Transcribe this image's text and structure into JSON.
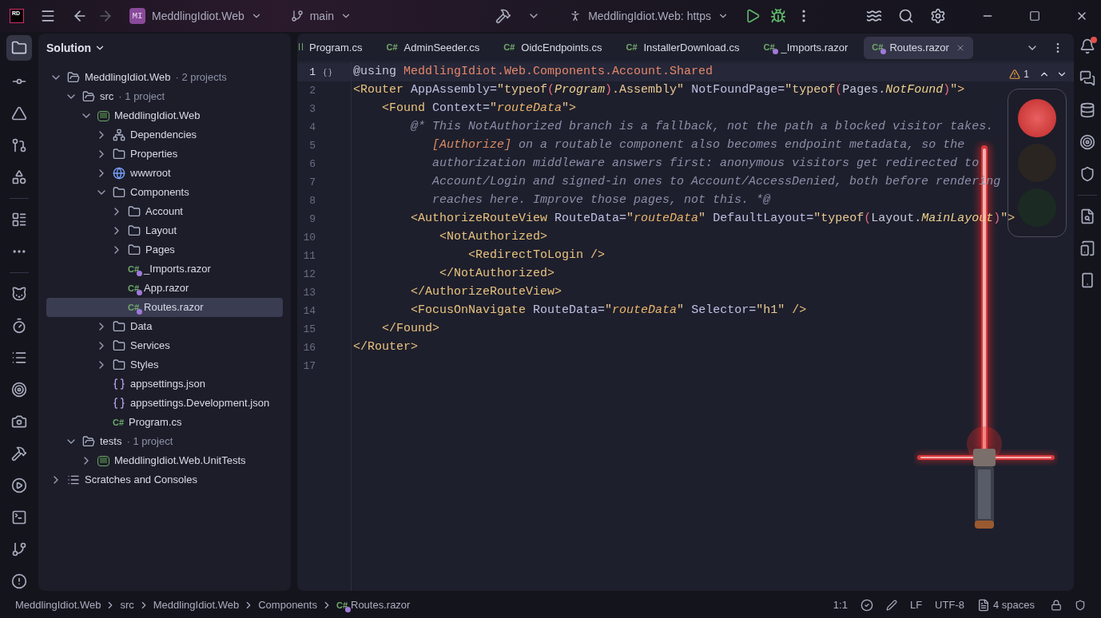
{
  "titlebar": {
    "logo": "RD",
    "project_badge": "MI",
    "project": "MeddlingIdiot.Web",
    "branch": "main",
    "run_config": "MeddlingIdiot.Web: https"
  },
  "solution": {
    "title": "Solution",
    "tree": [
      {
        "label": "MeddlingIdiot.Web",
        "meta": "· 2 projects",
        "kind": "solution",
        "expanded": true,
        "selected": false,
        "children": [
          {
            "label": "src",
            "meta": "· 1 project",
            "kind": "solution-folder",
            "expanded": true,
            "selected": false,
            "children": [
              {
                "label": "MeddlingIdiot.Web",
                "kind": "project",
                "expanded": true,
                "selected": false,
                "children": [
                  {
                    "label": "Dependencies",
                    "kind": "dependencies",
                    "expanded": false,
                    "selected": false
                  },
                  {
                    "label": "Properties",
                    "kind": "properties",
                    "expanded": false,
                    "selected": false
                  },
                  {
                    "label": "wwwroot",
                    "kind": "web-folder",
                    "expanded": false,
                    "selected": false
                  },
                  {
                    "label": "Components",
                    "kind": "folder",
                    "expanded": true,
                    "selected": false,
                    "children": [
                      {
                        "label": "Account",
                        "kind": "folder",
                        "expanded": false,
                        "selected": false
                      },
                      {
                        "label": "Layout",
                        "kind": "folder",
                        "expanded": false,
                        "selected": false
                      },
                      {
                        "label": "Pages",
                        "kind": "folder",
                        "expanded": false,
                        "selected": false
                      },
                      {
                        "label": "_Imports.razor",
                        "kind": "razor",
                        "badge": "C#",
                        "selected": false
                      },
                      {
                        "label": "App.razor",
                        "kind": "razor",
                        "badge": "C#",
                        "selected": false
                      },
                      {
                        "label": "Routes.razor",
                        "kind": "razor",
                        "badge": "C#",
                        "selected": true
                      }
                    ]
                  },
                  {
                    "label": "Data",
                    "kind": "folder",
                    "expanded": false,
                    "selected": false
                  },
                  {
                    "label": "Services",
                    "kind": "folder",
                    "expanded": false,
                    "selected": false
                  },
                  {
                    "label": "Styles",
                    "kind": "folder",
                    "expanded": false,
                    "selected": false
                  },
                  {
                    "label": "appsettings.json",
                    "kind": "json",
                    "selected": false
                  },
                  {
                    "label": "appsettings.Development.json",
                    "kind": "json",
                    "selected": false
                  },
                  {
                    "label": "Program.cs",
                    "kind": "cs",
                    "badge": "C#",
                    "selected": false
                  }
                ]
              }
            ]
          },
          {
            "label": "tests",
            "meta": "· 1 project",
            "kind": "solution-folder",
            "expanded": true,
            "selected": false,
            "children": [
              {
                "label": "MeddlingIdiot.Web.UnitTests",
                "kind": "project",
                "expanded": false,
                "selected": false
              }
            ]
          }
        ]
      },
      {
        "label": "Scratches and Consoles",
        "kind": "scratches",
        "expanded": false,
        "selected": false
      }
    ]
  },
  "tabs": [
    {
      "label": "Program.cs",
      "kind": "cs-cut",
      "selected": false
    },
    {
      "label": "AdminSeeder.cs",
      "kind": "cs",
      "badge": "C#",
      "selected": false
    },
    {
      "label": "OidcEndpoints.cs",
      "kind": "cs",
      "badge": "C#",
      "selected": false
    },
    {
      "label": "InstallerDownload.cs",
      "kind": "cs",
      "badge": "C#",
      "selected": false
    },
    {
      "label": "_Imports.razor",
      "kind": "razor",
      "badge": "C#",
      "selected": false
    },
    {
      "label": "Routes.razor",
      "kind": "razor",
      "badge": "C#",
      "selected": true
    }
  ],
  "inspections": {
    "warnings": "1"
  },
  "code": [
    {
      "n": "1",
      "current": true,
      "tokens": [
        {
          "t": "@using ",
          "kind": "text"
        },
        {
          "t": "MeddlingIdiot.Web.Components.Account.Shared",
          "kind": "ns"
        }
      ]
    },
    {
      "n": "2",
      "current": false,
      "tokens": [
        {
          "t": "<Router",
          "kind": "tag"
        },
        {
          "t": " AppAssembly=",
          "kind": "attr"
        },
        {
          "t": "\"typeof",
          "kind": "str"
        },
        {
          "t": "(",
          "kind": "paren"
        },
        {
          "t": "Program",
          "kind": "type"
        },
        {
          "t": ")",
          "kind": "paren"
        },
        {
          "t": ".Assembly\"",
          "kind": "str"
        },
        {
          "t": " NotFoundPage=",
          "kind": "attr"
        },
        {
          "t": "\"typeof",
          "kind": "str"
        },
        {
          "t": "(",
          "kind": "paren"
        },
        {
          "t": "Pages.",
          "kind": "text"
        },
        {
          "t": "NotFound",
          "kind": "type"
        },
        {
          "t": ")",
          "kind": "paren"
        },
        {
          "t": "\"",
          "kind": "str"
        },
        {
          "t": ">",
          "kind": "tag"
        }
      ]
    },
    {
      "n": "3",
      "current": false,
      "tokens": [
        {
          "t": "    <Found",
          "kind": "tag"
        },
        {
          "t": " Context=",
          "kind": "attr"
        },
        {
          "t": "\"",
          "kind": "str"
        },
        {
          "t": "routeData",
          "kind": "param"
        },
        {
          "t": "\"",
          "kind": "str"
        },
        {
          "t": ">",
          "kind": "tag"
        }
      ]
    },
    {
      "n": "4",
      "current": false,
      "tokens": [
        {
          "t": "        @* This NotAuthorized branch is a fallback, not the path a blocked visitor takes.",
          "kind": "comment"
        }
      ]
    },
    {
      "n": "5",
      "current": false,
      "tokens": [
        {
          "t": "           [Authorize]",
          "kind": "ref"
        },
        {
          "t": " on a routable component also becomes endpoint metadata, so the",
          "kind": "comment"
        }
      ]
    },
    {
      "n": "6",
      "current": false,
      "tokens": [
        {
          "t": "           authorization middleware answers first: anonymous visitors get redirected to",
          "kind": "comment"
        }
      ]
    },
    {
      "n": "7",
      "current": false,
      "tokens": [
        {
          "t": "           Account/Login and signed-in ones to Account/AccessDenied, both before rendering",
          "kind": "comment"
        }
      ]
    },
    {
      "n": "8",
      "current": false,
      "tokens": [
        {
          "t": "           reaches here. Improve those pages, not this. *@",
          "kind": "comment"
        }
      ]
    },
    {
      "n": "9",
      "current": false,
      "tokens": [
        {
          "t": "        <AuthorizeRouteView",
          "kind": "tag"
        },
        {
          "t": " RouteData=",
          "kind": "attr"
        },
        {
          "t": "\"",
          "kind": "str"
        },
        {
          "t": "routeData",
          "kind": "param"
        },
        {
          "t": "\"",
          "kind": "str"
        },
        {
          "t": " DefaultLayout=",
          "kind": "attr"
        },
        {
          "t": "\"typeof",
          "kind": "str"
        },
        {
          "t": "(",
          "kind": "paren"
        },
        {
          "t": "Layout.",
          "kind": "text"
        },
        {
          "t": "MainLayout",
          "kind": "type"
        },
        {
          "t": ")",
          "kind": "paren"
        },
        {
          "t": "\"",
          "kind": "str"
        },
        {
          "t": ">",
          "kind": "tag"
        }
      ]
    },
    {
      "n": "10",
      "current": false,
      "tokens": [
        {
          "t": "            <NotAuthorized>",
          "kind": "tag"
        }
      ]
    },
    {
      "n": "11",
      "current": false,
      "tokens": [
        {
          "t": "                <RedirectToLogin />",
          "kind": "tag"
        }
      ]
    },
    {
      "n": "12",
      "current": false,
      "tokens": [
        {
          "t": "            </NotAuthorized>",
          "kind": "tag"
        }
      ]
    },
    {
      "n": "13",
      "current": false,
      "tokens": [
        {
          "t": "        </AuthorizeRouteView>",
          "kind": "tag"
        }
      ]
    },
    {
      "n": "14",
      "current": false,
      "tokens": [
        {
          "t": "        <FocusOnNavigate",
          "kind": "tag"
        },
        {
          "t": " RouteData=",
          "kind": "attr"
        },
        {
          "t": "\"",
          "kind": "str"
        },
        {
          "t": "routeData",
          "kind": "param"
        },
        {
          "t": "\"",
          "kind": "str"
        },
        {
          "t": " Selector=",
          "kind": "attr"
        },
        {
          "t": "\"h1\"",
          "kind": "str"
        },
        {
          "t": " />",
          "kind": "tag"
        }
      ]
    },
    {
      "n": "15",
      "current": false,
      "tokens": [
        {
          "t": "    </Found>",
          "kind": "tag"
        }
      ]
    },
    {
      "n": "16",
      "current": false,
      "tokens": [
        {
          "t": "</Router>",
          "kind": "tag"
        }
      ]
    },
    {
      "n": "17",
      "current": false
    }
  ],
  "status_bar": {
    "breadcrumbs": [
      {
        "label": "MeddlingIdiot.Web",
        "kind": "plain"
      },
      {
        "label": "src",
        "kind": "plain"
      },
      {
        "label": "MeddlingIdiot.Web",
        "kind": "plain"
      },
      {
        "label": "Components",
        "kind": "plain"
      },
      {
        "label": "Routes.razor",
        "kind": "razor",
        "badge": "C#"
      }
    ],
    "position": "1:1",
    "line_ending": "LF",
    "encoding": "UTF-8",
    "indent": "4 spaces"
  }
}
